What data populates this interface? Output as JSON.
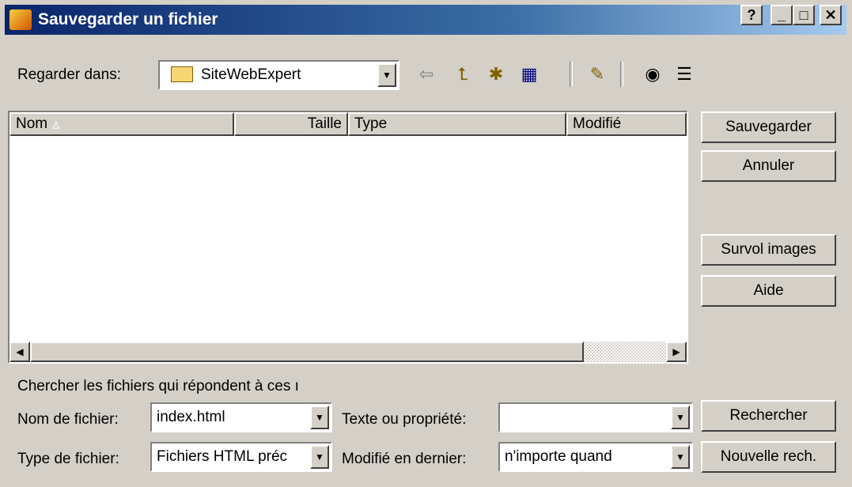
{
  "window": {
    "title": "Sauvegarder un fichier",
    "help_glyph": "?",
    "minimize_glyph": "_",
    "maximize_glyph": "□",
    "close_glyph": "✕"
  },
  "lookin": {
    "label": "Regarder dans:",
    "value": "SiteWebExpert"
  },
  "toolbar": {
    "icons": [
      "back-icon",
      "up-folder-icon",
      "new-folder-icon",
      "view-menu-icon",
      "properties-icon",
      "preview-icon",
      "details-icon"
    ]
  },
  "filelist": {
    "columns": [
      "Nom",
      "Taille",
      "Type",
      "Modifié"
    ],
    "sort_glyph": "▵",
    "rows": []
  },
  "buttons": {
    "save": "Sauvegarder",
    "cancel": "Annuler",
    "preview": "Survol images",
    "help": "Aide",
    "search": "Rechercher",
    "new_search": "Nouvelle rech."
  },
  "search": {
    "caption": "Chercher les fichiers qui répondent à ces ı",
    "filename_label": "Nom de fichier:",
    "filename_value": "index.html",
    "filetype_label": "Type de fichier:",
    "filetype_value": "Fichiers HTML préc",
    "text_label": "Texte ou propriété:",
    "text_value": "",
    "modified_label": "Modifié en dernier:",
    "modified_value": "n'importe quand"
  }
}
